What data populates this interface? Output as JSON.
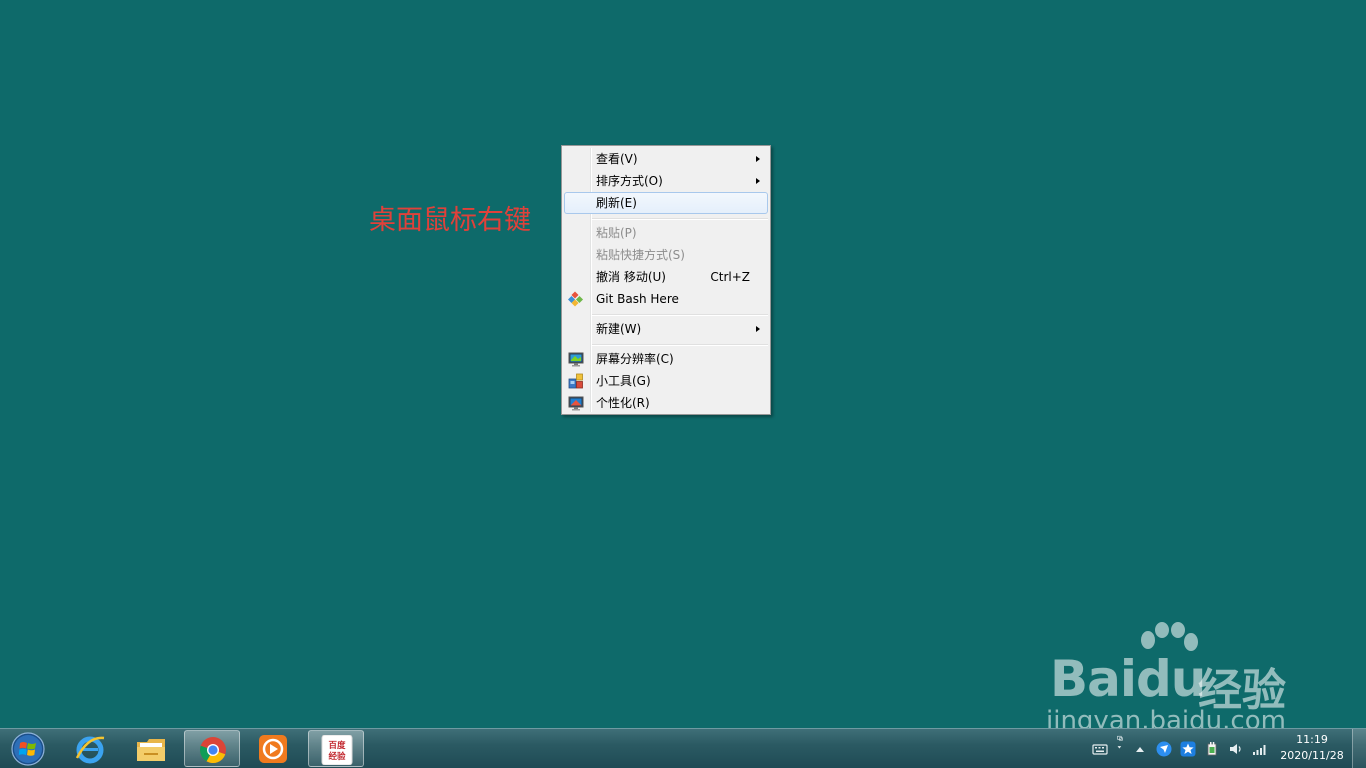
{
  "annotation": "桌面鼠标右键",
  "context_menu": {
    "items": [
      {
        "label": "查看(V)",
        "submenu": true
      },
      {
        "label": "排序方式(O)",
        "submenu": true
      },
      {
        "label": "刷新(E)",
        "highlighted": true
      },
      {
        "label": "粘贴(P)",
        "disabled": true
      },
      {
        "label": "粘贴快捷方式(S)",
        "disabled": true
      },
      {
        "label": "撤消 移动(U)",
        "shortcut": "Ctrl+Z"
      },
      {
        "label": "Git Bash Here",
        "icon": "git-icon"
      },
      {
        "label": "新建(W)",
        "submenu": true
      },
      {
        "label": "屏幕分辨率(C)",
        "icon": "monitor-icon"
      },
      {
        "label": "小工具(G)",
        "icon": "gadgets-icon"
      },
      {
        "label": "个性化(R)",
        "icon": "personalize-icon"
      }
    ]
  },
  "watermark": {
    "logo": "Baidu",
    "product": "经验",
    "url": "jingyan.baidu.com"
  },
  "taskbar": {
    "apps": [
      {
        "name": "internet-explorer-icon"
      },
      {
        "name": "file-explorer-icon"
      },
      {
        "name": "chrome-icon",
        "active": true
      },
      {
        "name": "media-player-icon"
      },
      {
        "name": "baidu-jingyan-icon",
        "label_line1": "百度",
        "label_line2": "经验",
        "active": true
      }
    ],
    "clock": {
      "time": "11:19",
      "date": "2020/11/28"
    }
  },
  "colors": {
    "desktop": "#0e6a6a",
    "annotation": "#e0413a",
    "menu_bg": "#f0f0f0"
  }
}
